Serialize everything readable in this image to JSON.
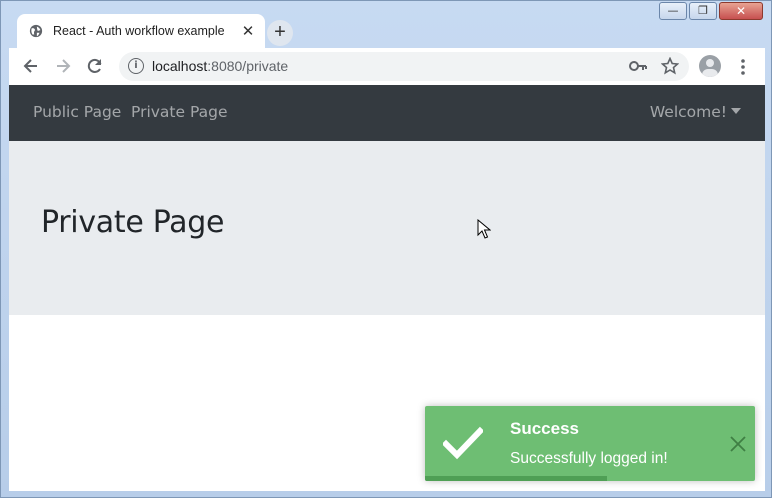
{
  "browser": {
    "tab_title": "React - Auth workflow example",
    "tab_close": "✕",
    "new_tab": "+",
    "url_host": "localhost",
    "url_path": ":8080/private",
    "window_minimize": "—",
    "window_maximize": "❐",
    "window_close": "✕"
  },
  "navbar": {
    "links": [
      "Public Page",
      "Private Page"
    ],
    "welcome": "Welcome!"
  },
  "main": {
    "heading": "Private Page"
  },
  "toast": {
    "title": "Success",
    "message": "Successfully logged in!",
    "progress": 0.55,
    "color": "#6ebe73"
  },
  "icons": {
    "favicon": "globe-icon",
    "back": "arrow-left-icon",
    "forward": "arrow-right-icon",
    "reload": "reload-icon",
    "site_info": "info-icon",
    "password_key": "key-icon",
    "bookmark": "star-icon",
    "profile": "avatar-icon",
    "menu": "more-vertical-icon",
    "toast_check": "check-icon",
    "toast_close": "close-icon"
  }
}
